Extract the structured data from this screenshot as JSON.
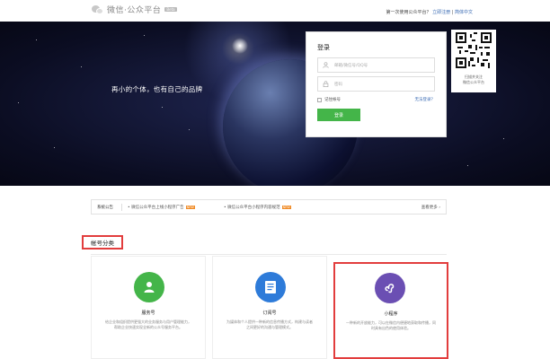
{
  "header": {
    "logo_text": "微信·公众平台",
    "beta_badge": "Beta",
    "prompt": "第一次使用公众平台？",
    "register_link": "立即注册",
    "language_link": "简体中文"
  },
  "banner": {
    "slogan": "再小的个体，也有自己的品牌"
  },
  "login": {
    "title": "登录",
    "account_placeholder": "邮箱/微信号/QQ号",
    "password_placeholder": "密码",
    "remember_label": "记住帐号",
    "forgot_link": "无法登录？",
    "submit_label": "登录"
  },
  "qr": {
    "caption_line1": "扫描并关注",
    "caption_line2": "微信公众平台"
  },
  "notice": {
    "label": "系统公告",
    "item1": "微信公众平台上线小程序广告",
    "item2": "微信公众平台小程序内容规范",
    "new_badge": "NEW",
    "more": "查看更多"
  },
  "section": {
    "title": "帐号分类"
  },
  "cards": [
    {
      "name": "服务号",
      "description": "给企业和组织提供更强大的业务服务与用户管理能力，帮助企业快速实现全新的公众号服务平台。",
      "color": "#44b549"
    },
    {
      "name": "订阅号",
      "description": "为媒体和个人提供一种新的信息传播方式，构建与读者之间更好的沟通与管理模式。",
      "color": "#2e7bd9"
    },
    {
      "name": "小程序",
      "description": "一种新的开放能力，可以在微信内便捷地获取和传播，同时具有出色的使用体验。",
      "color": "#6b4fb3"
    }
  ]
}
